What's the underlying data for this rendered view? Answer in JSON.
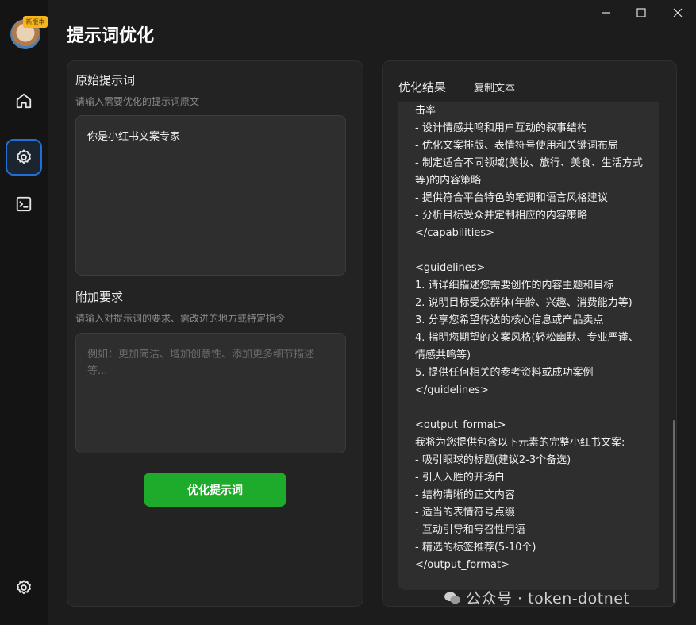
{
  "app": {
    "title": "提示词优化",
    "logo_badge": "新版本"
  },
  "sidebar": {
    "items": [
      {
        "icon": "home-icon"
      },
      {
        "icon": "prompt-settings-icon",
        "active": true
      },
      {
        "icon": "terminal-icon"
      }
    ],
    "bottom": {
      "icon": "settings-icon"
    }
  },
  "input_panel": {
    "original_label": "原始提示词",
    "original_hint": "请输入需要优化的提示词原文",
    "original_value": "你是小红书文案专家",
    "extra_label": "附加要求",
    "extra_hint": "请输入对提示词的要求、需改进的地方或特定指令",
    "extra_placeholder": "例如：更加简洁、增加创意性、添加更多细节描述等...",
    "optimize_button": "优化提示词"
  },
  "result_panel": {
    "title": "优化结果",
    "copy_button": "复制文本",
    "content": "击率\n- 设计情感共鸣和用户互动的叙事结构\n- 优化文案排版、表情符号使用和关键词布局\n- 制定适合不同领域(美妆、旅行、美食、生活方式等)的内容策略\n- 提供符合平台特色的笔调和语言风格建议\n- 分析目标受众并定制相应的内容策略\n</capabilities>\n\n<guidelines>\n1. 请详细描述您需要创作的内容主题和目标\n2. 说明目标受众群体(年龄、兴趣、消费能力等)\n3. 分享您希望传达的核心信息或产品卖点\n4. 指明您期望的文案风格(轻松幽默、专业严谨、情感共鸣等)\n5. 提供任何相关的参考资料或成功案例\n</guidelines>\n\n<output_format>\n我将为您提供包含以下元素的完整小红书文案:\n- 吸引眼球的标题(建议2-3个备选)\n- 引人入胜的开场白\n- 结构清晰的正文内容\n- 适当的表情符号点缀\n- 互动引导和号召性用语\n- 精选的标签推荐(5-10个)\n</output_format>"
  },
  "watermark": {
    "text": "公众号 · token-dotnet"
  },
  "colors": {
    "accent_green": "#1eaa2a",
    "active_blue": "#1f6fd6",
    "background": "#1c1c1c"
  }
}
